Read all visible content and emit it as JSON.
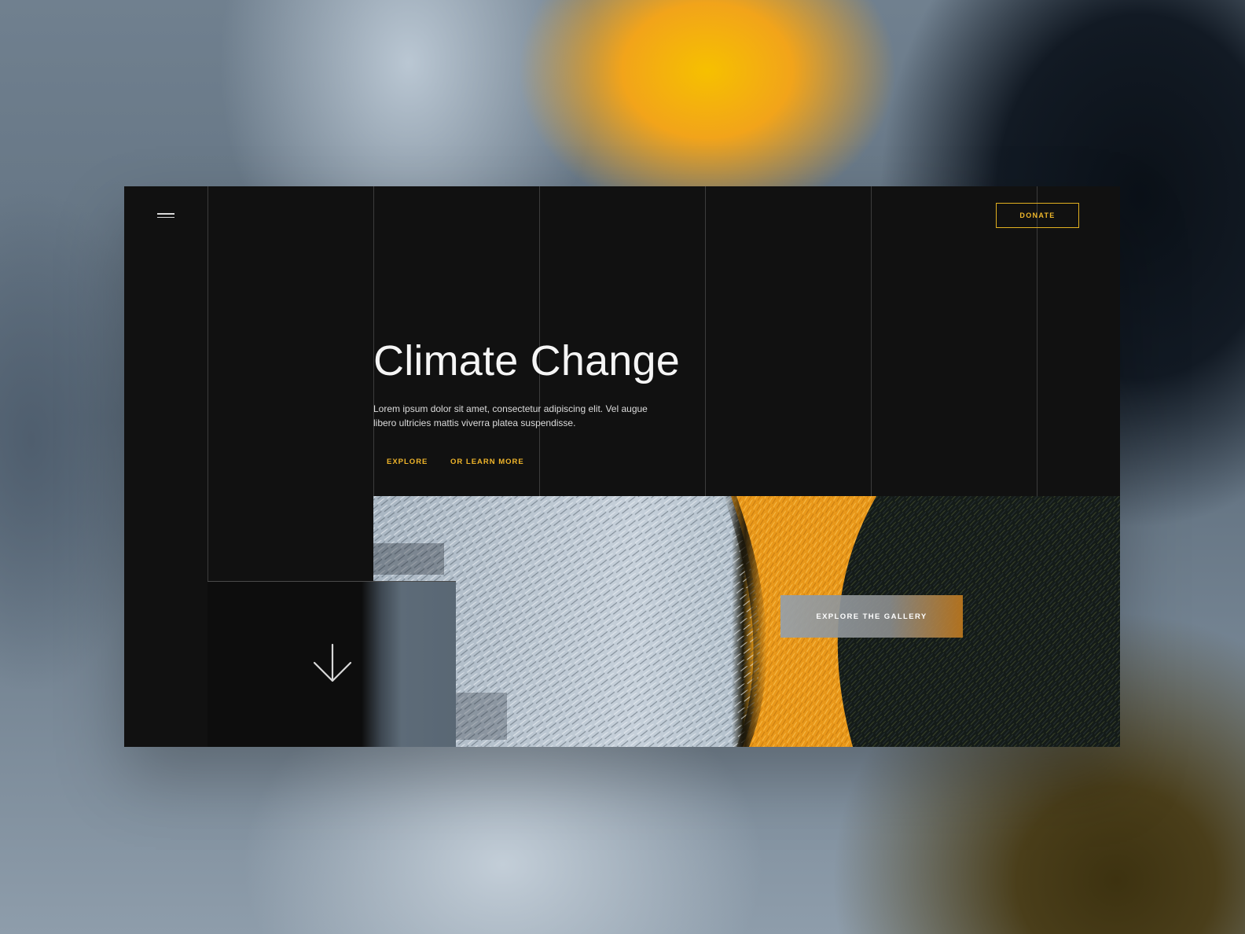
{
  "nav": {
    "menu_icon": "hamburger-menu-icon",
    "donate_label": "DONATE"
  },
  "hero": {
    "title": "Climate Change",
    "body": "Lorem ipsum dolor sit amet, consectetur adipiscing elit. Vel augue libero ultricies mattis viverra platea suspendisse.",
    "explore_label": "EXPLORE",
    "learn_more_label": "OR LEARN MORE"
  },
  "gallery": {
    "button_label": "EXPLORE THE GALLERY"
  },
  "scroll": {
    "icon": "arrow-down-icon"
  },
  "colors": {
    "accent": "#f0b52a",
    "panel": "#111111",
    "text": "#f5f5f5"
  }
}
